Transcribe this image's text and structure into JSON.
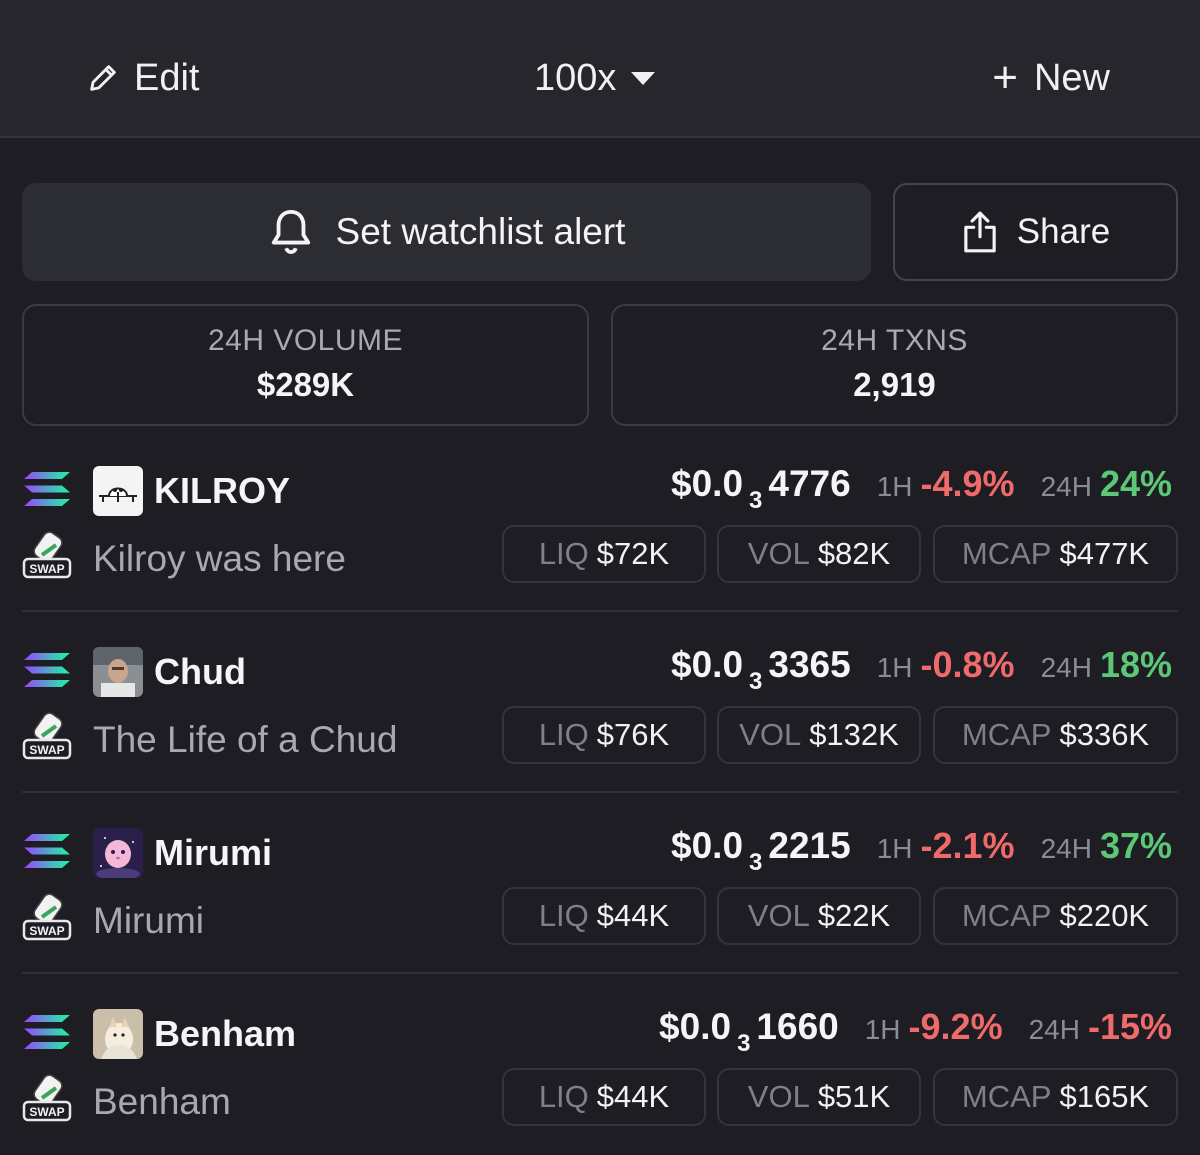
{
  "header": {
    "edit_label": "Edit",
    "list_title": "100x",
    "new_label": "New"
  },
  "actions": {
    "alert_label": "Set watchlist alert",
    "share_label": "Share"
  },
  "stats": {
    "volume_label": "24H VOLUME",
    "volume_value": "$289K",
    "txns_label": "24H TXNS",
    "txns_value": "2,919"
  },
  "labels": {
    "h1": "1H",
    "h24": "24H",
    "liq": "LIQ",
    "vol": "VOL",
    "mcap": "MCAP",
    "swap": "SWAP"
  },
  "colors": {
    "negative": "#ef6a6a",
    "positive": "#5cc777",
    "background": "#1d1d23"
  },
  "tokens": [
    {
      "symbol": "KILROY",
      "name": "Kilroy was here",
      "price_prefix": "$0.0",
      "price_zeros": "3",
      "price_digits": "4776",
      "change_1h": "-4.9%",
      "change_24h": "24%",
      "change_24h_dir": "pos",
      "liq": "$72K",
      "vol": "$82K",
      "mcap": "$477K",
      "icon": "kilroy-logo-icon"
    },
    {
      "symbol": "Chud",
      "name": "The Life of a Chud",
      "price_prefix": "$0.0",
      "price_zeros": "3",
      "price_digits": "3365",
      "change_1h": "-0.8%",
      "change_24h": "18%",
      "change_24h_dir": "pos",
      "liq": "$76K",
      "vol": "$132K",
      "mcap": "$336K",
      "icon": "chud-avatar-icon"
    },
    {
      "symbol": "Mirumi",
      "name": "Mirumi",
      "price_prefix": "$0.0",
      "price_zeros": "3",
      "price_digits": "2215",
      "change_1h": "-2.1%",
      "change_24h": "37%",
      "change_24h_dir": "pos",
      "liq": "$44K",
      "vol": "$22K",
      "mcap": "$220K",
      "icon": "mirumi-avatar-icon"
    },
    {
      "symbol": "Benham",
      "name": "Benham",
      "price_prefix": "$0.0",
      "price_zeros": "3",
      "price_digits": "1660",
      "change_1h": "-9.2%",
      "change_24h": "-15%",
      "change_24h_dir": "neg",
      "liq": "$44K",
      "vol": "$51K",
      "mcap": "$165K",
      "icon": "benham-avatar-icon"
    }
  ]
}
